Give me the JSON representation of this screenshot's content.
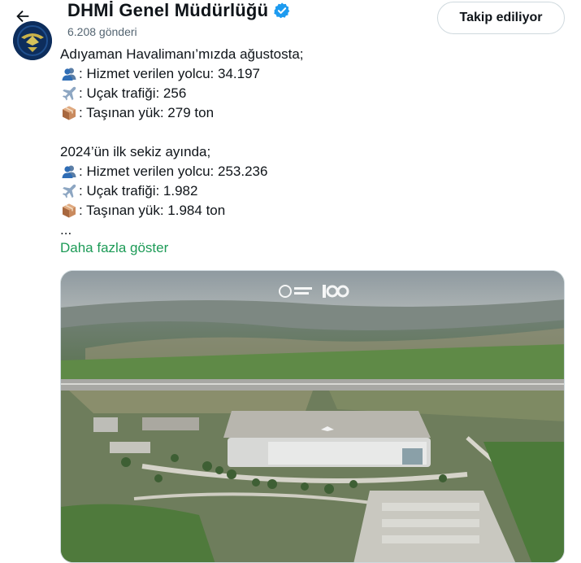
{
  "header": {
    "name": "DHMİ Genel Müdürlüğü",
    "post_count": "6.208 gönderi",
    "follow_label": "Takip ediliyor"
  },
  "icons": {
    "back": "back-arrow-icon",
    "verified": "verified-badge-icon",
    "passenger": "busts-in-silhouette-emoji",
    "plane": "airplane-emoji",
    "cargo": "package-emoji"
  },
  "colors": {
    "link_green": "#1d9b57",
    "verified_blue": "#1d9bf0",
    "muted_text": "#536471"
  },
  "post": {
    "august_heading": "Adıyaman Havalimanı’mızda ağustosta;",
    "august_passengers": ": Hizmet verilen yolcu: 34.197",
    "august_flights": ": Uçak trafiği: 256",
    "august_cargo": ": Taşınan yük: 279 ton",
    "ytd_heading": "2024’ün ilk sekiz ayında;",
    "ytd_passengers": ": Hizmet verilen yolcu: 253.236",
    "ytd_flights": ": Uçak trafiği: 1.982",
    "ytd_cargo": ": Taşınan yük: 1.984 ton",
    "ellipsis": "...",
    "show_more": "Daha fazla göster"
  }
}
